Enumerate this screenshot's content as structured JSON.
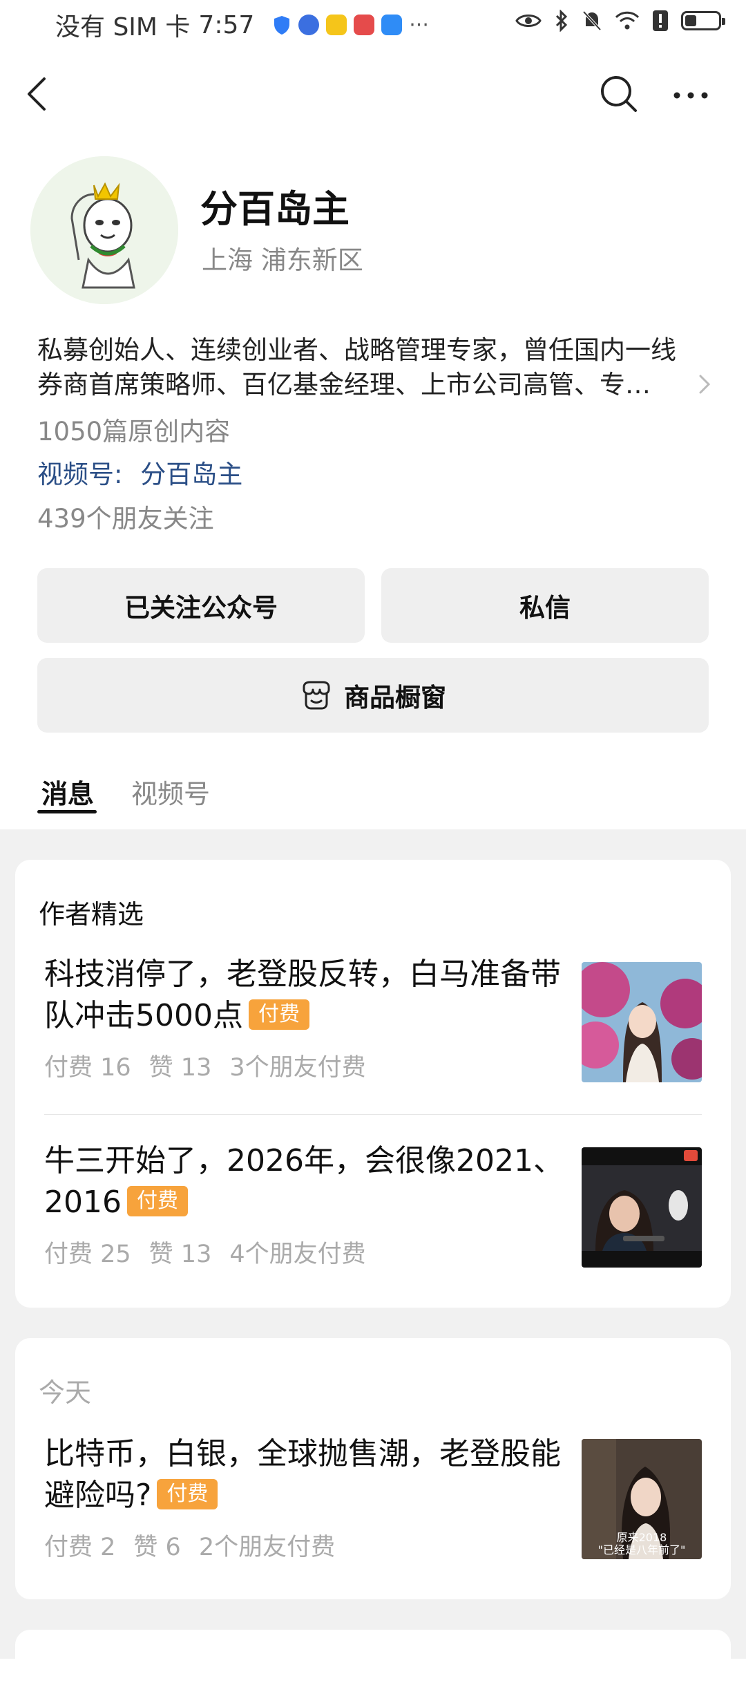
{
  "status_bar": {
    "carrier": "没有 SIM 卡",
    "time": "7:57",
    "more": "···"
  },
  "header": {
    "back_icon": "chevron-left-icon",
    "search_icon": "search-icon",
    "more_icon": "more-horizontal-icon"
  },
  "profile": {
    "name": "分百岛主",
    "location": "上海 浦东新区",
    "bio_line1": "私募创始人、连续创业者、战略管理专家，曾任国内一线",
    "bio_line2": "券商首席策略师、百亿基金经理、上市公司高管、专…",
    "original_count": "1050篇原创内容",
    "channel_label": "视频号:",
    "channel_name": "分百岛主",
    "friends_follow": "439个朋友关注"
  },
  "actions": {
    "followed": "已关注公众号",
    "message": "私信",
    "shop": "商品橱窗"
  },
  "tabs": [
    {
      "label": "消息",
      "active": true
    },
    {
      "label": "视频号",
      "active": false
    }
  ],
  "featured": {
    "title": "作者精选",
    "articles": [
      {
        "title": "科技消停了，老登股反转，白马准备带队冲击5000点",
        "tag": "付费",
        "paid": "付费 16",
        "likes": "赞 13",
        "friends": "3个朋友付费"
      },
      {
        "title": "牛三开始了，2026年，会很像2021、2016",
        "tag": "付费",
        "paid": "付费 25",
        "likes": "赞 13",
        "friends": "4个朋友付费"
      }
    ]
  },
  "today": {
    "label": "今天",
    "articles": [
      {
        "title": "比特币，白银，全球抛售潮，老登股能避险吗?",
        "tag": "付费",
        "paid": "付费 2",
        "likes": "赞 6",
        "friends": "2个朋友付费",
        "thumb_caption_1": "原来2018",
        "thumb_caption_2": "\"已经是八年前了\""
      }
    ]
  },
  "colors": {
    "paid_tag": "#f7a33c",
    "link_blue": "#2a4e86",
    "button_bg": "#efefef",
    "page_bg_lower": "#f1f1f1"
  }
}
